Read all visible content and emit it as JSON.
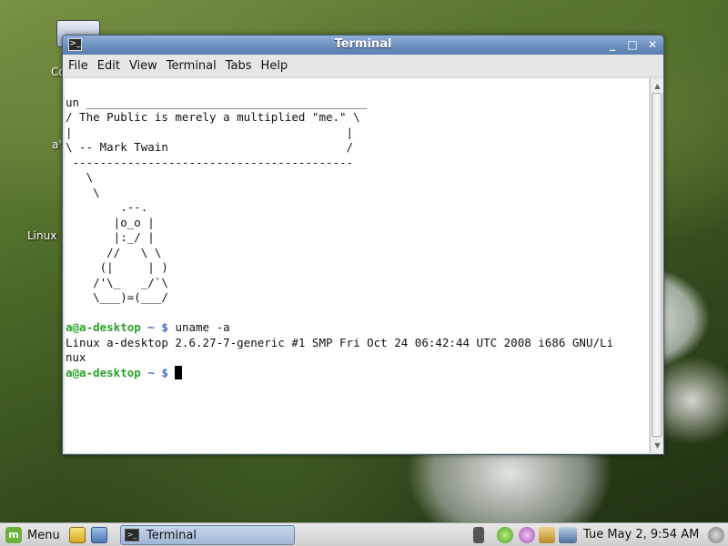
{
  "desktop": {
    "icons": [
      {
        "label": "Co"
      },
      {
        "label": "a'"
      },
      {
        "label": "Linux"
      }
    ]
  },
  "window": {
    "title": "Terminal",
    "menu": [
      "File",
      "Edit",
      "View",
      "Terminal",
      "Tabs",
      "Help"
    ],
    "controls": {
      "minimize": "_",
      "maximize": "□",
      "close": "✕"
    }
  },
  "terminal": {
    "cowsay_lines": [
      "un _________________________________________",
      "/ The Public is merely a multiplied \"me.\" \\",
      "|                                        |",
      "\\ -- Mark Twain                          /",
      " -----------------------------------------",
      "   \\",
      "    \\",
      "        .--.",
      "       |o_o |",
      "       |:_/ |",
      "      //   \\ \\",
      "     (|     | )",
      "    /'\\_   _/`\\",
      "    \\___)=(___/"
    ],
    "prompt_user": "a@a-desktop",
    "prompt_path": "~",
    "prompt_symbol": "$",
    "command": "uname -a",
    "output_lines": [
      "Linux a-desktop 2.6.27-7-generic #1 SMP Fri Oct 24 06:42:44 UTC 2008 i686 GNU/Li",
      "nux"
    ]
  },
  "panel": {
    "menu_label": "Menu",
    "task_label": "Terminal",
    "clock": "Tue May  2,  9:54 AM"
  }
}
